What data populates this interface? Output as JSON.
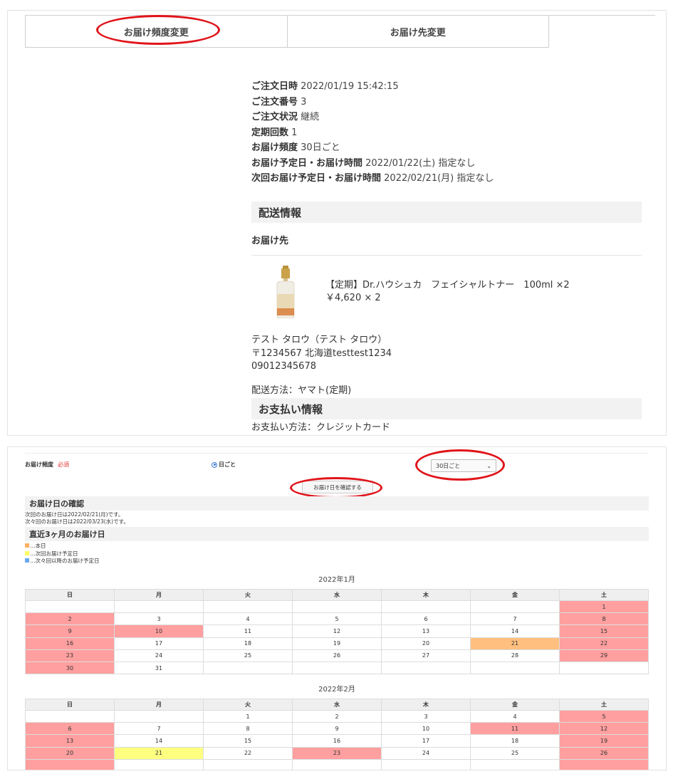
{
  "tabs": [
    {
      "label": "お届け頻度変更"
    },
    {
      "label": "お届け先変更"
    }
  ],
  "order": {
    "rows": [
      {
        "label": "ご注文日時",
        "value": "2022/01/19 15:42:15"
      },
      {
        "label": "ご注文番号",
        "value": "3"
      },
      {
        "label": "ご注文状況",
        "value": "継続"
      },
      {
        "label": "定期回数",
        "value": "1"
      },
      {
        "label": "お届け頻度",
        "value": "30日ごと"
      },
      {
        "label": "お届け予定日・お届け時間",
        "value": "2022/01/22(土) 指定なし"
      },
      {
        "label": "次回お届け予定日・お届け時間",
        "value": "2022/02/21(月) 指定なし"
      }
    ]
  },
  "shipping": {
    "heading": "配送情報",
    "subheading": "お届け先",
    "product_name": "【定期】Dr.ハウシュカ　フェイシャルトナー　100ml ×2",
    "product_price": "￥4,620 × 2",
    "address_name": "テスト タロウ（テスト タロウ）",
    "address_line": "〒1234567 北海道testtest1234",
    "phone": "09012345678",
    "method": "配送方法：ヤマト(定期)"
  },
  "payment": {
    "heading": "お支払い情報",
    "method": "お支払い方法：クレジットカード"
  },
  "frequency": {
    "label": "お届け頻度",
    "required": "必須",
    "radio_label": "日ごと",
    "select_value": "30日ごと",
    "confirm_button": "お届け日を確認する"
  },
  "confirm": {
    "heading": "お届け日の確認",
    "next": "次回のお届け日は2022/02/21(月)です。",
    "after_next": "次々回のお届け日は2022/03/23(水)です。"
  },
  "recent": {
    "heading": "直近3ヶ月のお届け日",
    "legend": [
      {
        "text": "…本日",
        "color": "#ffb060"
      },
      {
        "text": "…次回お届け予定日",
        "color": "#ffff60"
      },
      {
        "text": "…次々回以降のお届け予定日",
        "color": "#6aa8f0"
      }
    ]
  },
  "colors": {
    "holiday": "#ff9f9f",
    "today": "#ffbf7f",
    "next": "#ffff80",
    "accent": "#e0141a"
  },
  "calendar": {
    "weekdays": [
      "日",
      "月",
      "火",
      "水",
      "木",
      "金",
      "土"
    ],
    "months": [
      {
        "title": "2022年1月",
        "weeks": [
          [
            "",
            "",
            "",
            "",
            "",
            "",
            "1"
          ],
          [
            "2",
            "3",
            "4",
            "5",
            "6",
            "7",
            "8"
          ],
          [
            "9",
            "10",
            "11",
            "12",
            "13",
            "14",
            "15"
          ],
          [
            "16",
            "17",
            "18",
            "19",
            "20",
            "21",
            "22"
          ],
          [
            "23",
            "24",
            "25",
            "26",
            "27",
            "28",
            "29"
          ],
          [
            "30",
            "31",
            "",
            "",
            "",
            "",
            ""
          ]
        ],
        "marks": [
          [
            "",
            "",
            "",
            "",
            "",
            "",
            "r"
          ],
          [
            "r",
            "",
            "",
            "",
            "",
            "",
            "r"
          ],
          [
            "r",
            "r",
            "",
            "",
            "",
            "",
            "r"
          ],
          [
            "r",
            "",
            "",
            "",
            "",
            "o",
            "r"
          ],
          [
            "r",
            "",
            "",
            "",
            "",
            "",
            "r"
          ],
          [
            "r",
            "",
            "",
            "",
            "",
            "",
            ""
          ]
        ]
      },
      {
        "title": "2022年2月",
        "weeks": [
          [
            "",
            "",
            "1",
            "2",
            "3",
            "4",
            "5"
          ],
          [
            "6",
            "7",
            "8",
            "9",
            "10",
            "11",
            "12"
          ],
          [
            "13",
            "14",
            "15",
            "16",
            "17",
            "18",
            "19"
          ],
          [
            "20",
            "21",
            "22",
            "23",
            "24",
            "25",
            "26"
          ],
          [
            "",
            "",
            "",
            "",
            "",
            "",
            ""
          ]
        ],
        "marks": [
          [
            "",
            "",
            "",
            "",
            "",
            "",
            "r"
          ],
          [
            "r",
            "",
            "",
            "",
            "",
            "r",
            "r"
          ],
          [
            "r",
            "",
            "",
            "",
            "",
            "",
            "r"
          ],
          [
            "r",
            "y",
            "",
            "r",
            "",
            "",
            "r"
          ],
          [
            "r",
            "",
            "",
            "",
            "",
            "",
            "r"
          ]
        ]
      }
    ]
  }
}
